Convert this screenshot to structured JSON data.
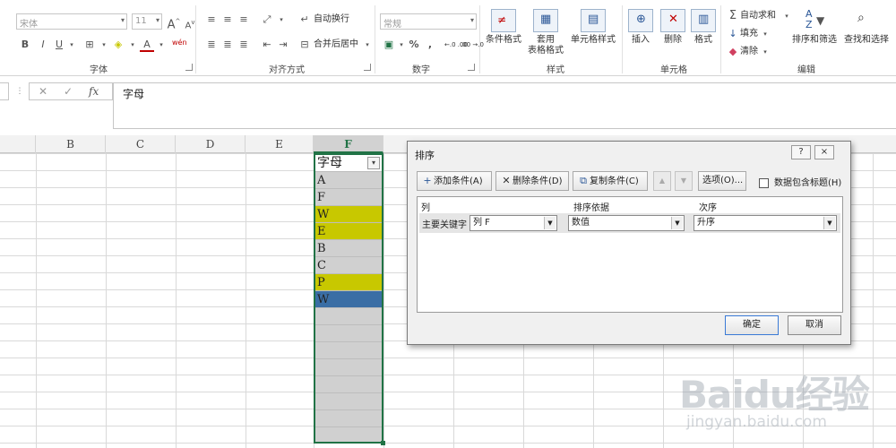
{
  "ribbon": {
    "font_group": {
      "font_name": "宋体",
      "font_size": "11",
      "grow_glyph": "A",
      "shrink_glyph": "A",
      "bold": "B",
      "italic": "I",
      "underline": "U",
      "font_color_glyph": "A",
      "phonetic": "wén",
      "label": "字体"
    },
    "alignment_group": {
      "wrap_text": "自动换行",
      "merge_center": "合并后居中",
      "label": "对齐方式"
    },
    "number_group": {
      "format": "常规",
      "percent": "%",
      "comma": ",",
      "inc_decimal": "←.0 .00",
      "dec_decimal": ".00 →.0",
      "label": "数字"
    },
    "styles_group": {
      "conditional_format": "条件格式",
      "format_as_table_1": "套用",
      "format_as_table_2": "表格格式",
      "cell_styles": "单元格样式",
      "label": "样式"
    },
    "cells_group": {
      "insert": "插入",
      "delete": "删除",
      "format": "格式",
      "label": "单元格"
    },
    "editing_group": {
      "autosum": "自动求和",
      "fill": "填充",
      "clear": "清除",
      "sort_filter": "排序和筛选",
      "find_select": "查找和选择",
      "label": "编辑"
    }
  },
  "formula_bar": {
    "fx": "fx",
    "value": "字母"
  },
  "grid": {
    "columns": [
      "B",
      "C",
      "D",
      "E",
      "F"
    ],
    "selected_column": "F",
    "f_header": "字母",
    "f_values": [
      "A",
      "F",
      "W",
      "E",
      "B",
      "C",
      "P",
      "W"
    ],
    "highlight_yellow": "#c8c800",
    "highlight_blue": "#3a6ea5"
  },
  "dialog": {
    "title": "排序",
    "help": "?",
    "close": "×",
    "add_level": "添加条件(A)",
    "delete_level": "删除条件(D)",
    "copy_level": "复制条件(C)",
    "move_up": "▲",
    "move_down": "▼",
    "options": "选项(O)...",
    "has_headers": "数据包含标题(H)",
    "col_header": "列",
    "sort_on_header": "排序依据",
    "order_header": "次序",
    "row_label": "主要关键字",
    "column_value": "列 F",
    "sort_on_value": "数值",
    "order_value": "升序",
    "ok": "确定",
    "cancel": "取消"
  },
  "watermark": {
    "logo": "Baidu经验",
    "url": "jingyan.baidu.com"
  }
}
